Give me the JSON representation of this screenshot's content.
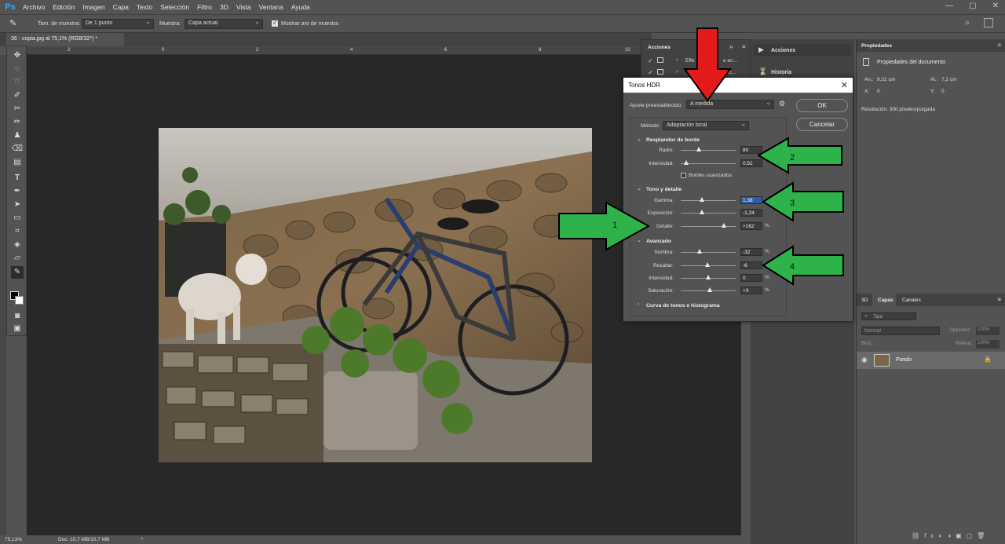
{
  "menubar": {
    "logo": "Ps",
    "items": [
      "Archivo",
      "Edición",
      "Imagen",
      "Capa",
      "Texto",
      "Selección",
      "Filtro",
      "3D",
      "Vista",
      "Ventana",
      "Ayuda"
    ]
  },
  "options": {
    "sample_size_label": "Tam. de muestra:",
    "sample_size_value": "De 1 punto",
    "sample_label": "Muestra:",
    "sample_value": "Capa actual",
    "show_ring_label": "Mostrar aro de muestra"
  },
  "document": {
    "tab_title": "36 - copia.jpg al 75,1% (RGB/32*) *",
    "ruler_ticks": [
      "2",
      "0",
      "2",
      "4",
      "6",
      "8",
      "10"
    ],
    "zoom": "75,13%",
    "doc_size": "Doc: 10,7 MB/10,7 MB"
  },
  "actions_panel": {
    "tab": "Acciones",
    "row1": "Effe",
    "row1_suffix": "e en...",
    "row2_suffix": "nc..."
  },
  "dock": {
    "acciones": "Acciones",
    "historia": "Historia"
  },
  "properties": {
    "tab": "Propiedades",
    "title": "Propiedades del documento",
    "width_label": "An.:",
    "width_value": "9,31 cm",
    "height_label": "Al.:",
    "height_value": "7,2 cm",
    "x_label": "X:",
    "x_value": "0",
    "y_label": "Y:",
    "y_value": "0",
    "resolution": "Resolución: 300 píxeles/pulgada"
  },
  "layers_panel": {
    "tabs": [
      "3D",
      "Capas",
      "Canales"
    ],
    "search": "Tipo",
    "blend_mode": "Normal",
    "opacity_label": "Opacidad:",
    "opacity_value": "100%",
    "lock_label": "Bloq.:",
    "fill_label": "Relleno:",
    "fill_value": "100%",
    "layer_name": "Fondo"
  },
  "dialog": {
    "title": "Tonos HDR",
    "preset_label": "Ajuste preestablecido:",
    "preset_value": "A medida",
    "ok": "OK",
    "cancel": "Cancelar",
    "method_label": "Método:",
    "method_value": "Adaptación local",
    "edge_group": "Resplandor de borde",
    "radius_label": "Radio:",
    "radius_value": "80",
    "strength_label": "Intensidad:",
    "strength_value": "0,52",
    "smooth_edges": "Bordes suavizados",
    "tone_group": "Tono y detalle",
    "gamma_label": "Gamma:",
    "gamma_value": "1,38",
    "exposure_label": "Exposición:",
    "exposure_value": "-1,24",
    "detail_label": "Detalle:",
    "detail_value": "+162",
    "detail_unit": "%",
    "advanced_group": "Avanzado",
    "shadow_label": "Sombra:",
    "shadow_value": "-32",
    "shadow_unit": "%",
    "highlight_label": "Resaltar:",
    "highlight_value": "-6",
    "highlight_unit": "%",
    "vibrance_label": "Intensidad:",
    "vibrance_value": "0",
    "vibrance_unit": "%",
    "saturation_label": "Saturación:",
    "saturation_value": "+3",
    "saturation_unit": "%",
    "curve_group": "Curva de tonos e histograma",
    "slider_levels": {
      "radius": 0.33,
      "strength": 0.1,
      "gamma": 0.38,
      "exposure": 0.38,
      "detail": 0.79,
      "shadow": 0.34,
      "highlight": 0.49,
      "vibrance": 0.5,
      "saturation": 0.53
    }
  },
  "annotations": {
    "arrow1": "1",
    "arrow2": "2",
    "arrow3": "3",
    "arrow4": "4",
    "green": "#2db34a",
    "red": "#e31b1b"
  },
  "colors": {
    "bg": "#535353",
    "canvas": "#282828",
    "accent": "#31a8ff"
  }
}
